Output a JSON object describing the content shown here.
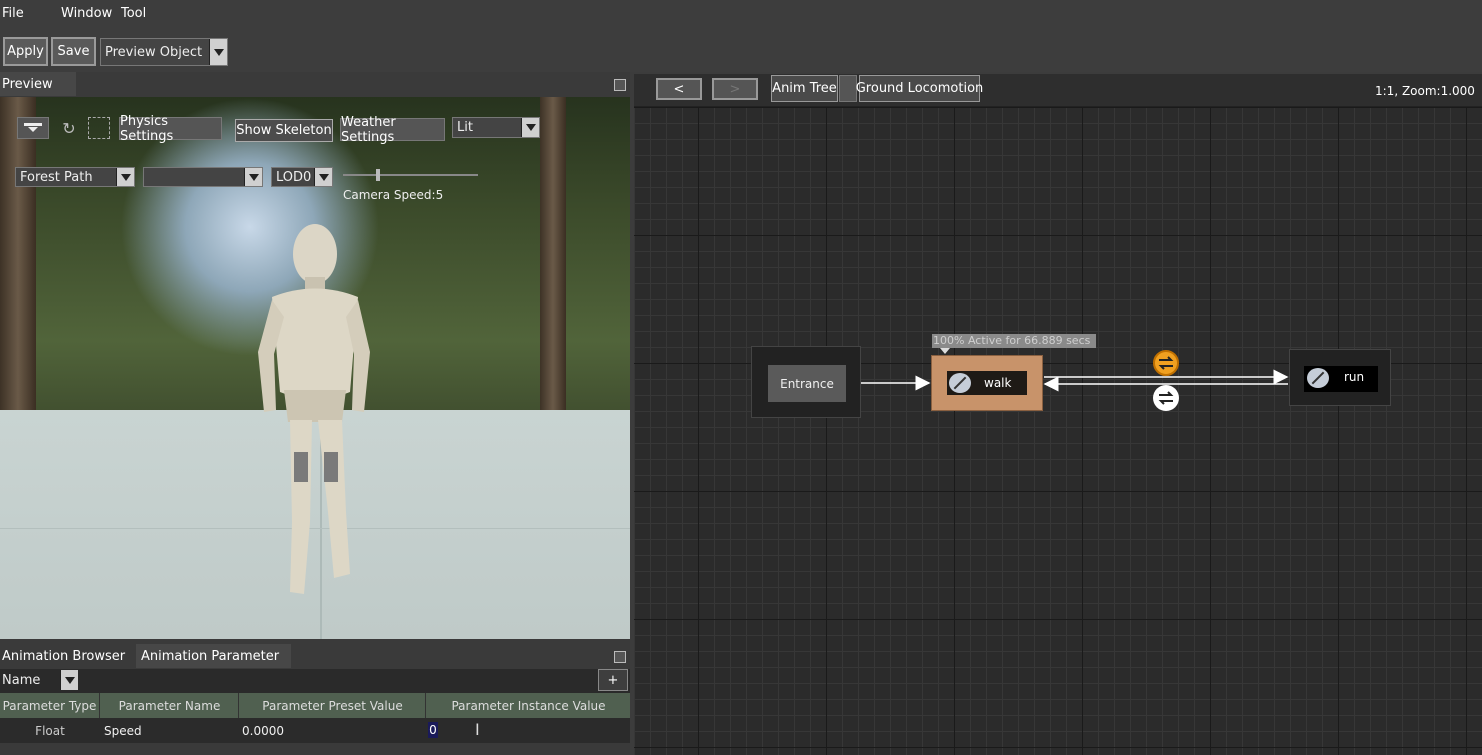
{
  "menu": {
    "file": "File",
    "window": "Window",
    "tool": "Tool"
  },
  "toolbar": {
    "apply": "Apply",
    "save": "Save",
    "preview_object": "Preview Object"
  },
  "preview_panel": {
    "tab": "Preview",
    "physics_settings": "Physics Settings",
    "show_skeleton": "Show Skeleton",
    "weather_settings": "Weather Settings",
    "shading_mode": "Lit",
    "scene": "Forest Path",
    "second_combo": "",
    "lod": "LOD0",
    "camera_speed": "Camera Speed:5"
  },
  "bottom_panel": {
    "tabs": [
      "Animation Browser",
      "Animation Parameter"
    ],
    "filter": "Name",
    "add": "+",
    "columns": [
      "Parameter Type",
      "Parameter Name",
      "Parameter Preset Value",
      "Parameter Instance Value"
    ],
    "rows": [
      {
        "type": "Float",
        "name": "Speed",
        "preset": "0.0000",
        "instance": "0"
      }
    ]
  },
  "graph": {
    "back": "<",
    "forward": ">",
    "breadcrumb": [
      "Anim Tree",
      "Ground Locomotion"
    ],
    "zoom": "1:1, Zoom:1.000",
    "entrance": "Entrance",
    "walk": "walk",
    "run": "run",
    "active_label": "100% Active for 66.889 secs",
    "colors": {
      "walk_node": "#c8936a",
      "transition_active": "#f0a020",
      "transition_idle": "#ffffff"
    }
  }
}
